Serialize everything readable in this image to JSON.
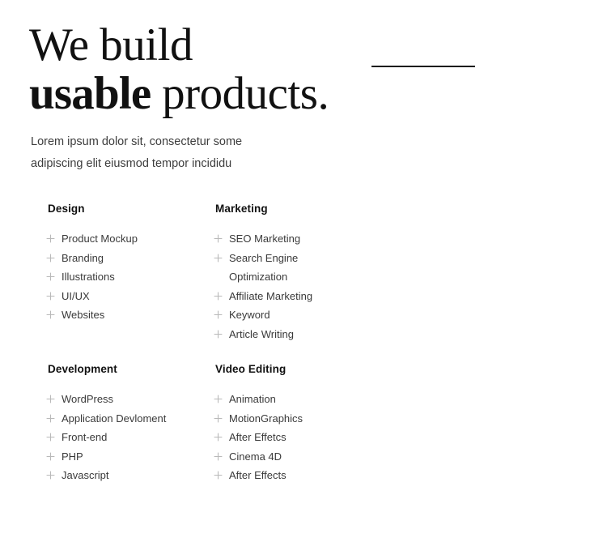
{
  "hero": {
    "headline_line1": "We build",
    "headline_line2_bold": "usable",
    "headline_line2_rest": " products.",
    "divider": "horizontal-rule"
  },
  "intro": {
    "line1": "Lorem ipsum dolor sit, consectetur some",
    "line2": "adipiscing elit eiusmod tempor incididu"
  },
  "colors": {
    "background": "#ffffff",
    "headline": "#111111",
    "body_text": "#3a3a3a",
    "intro_text": "#3d3d3d",
    "plus_icon": "#b9b9b9",
    "divider": "#1a1a1a"
  },
  "groups": [
    {
      "title": "Design",
      "items": [
        {
          "label": "Product Mockup",
          "icon": "plus-icon",
          "continuation": false
        },
        {
          "label": "Branding",
          "icon": "plus-icon",
          "continuation": false
        },
        {
          "label": "Illustrations",
          "icon": "plus-icon",
          "continuation": false
        },
        {
          "label": "UI/UX",
          "icon": "plus-icon",
          "continuation": false
        },
        {
          "label": "Websites",
          "icon": "plus-icon",
          "continuation": false
        }
      ]
    },
    {
      "title": "Marketing",
      "items": [
        {
          "label": "SEO Marketing",
          "icon": "plus-icon",
          "continuation": false
        },
        {
          "label": "Search Engine",
          "icon": "plus-icon",
          "continuation": false
        },
        {
          "label": "Optimization",
          "icon": "none",
          "continuation": true
        },
        {
          "label": "Affiliate Marketing",
          "icon": "plus-icon",
          "continuation": false
        },
        {
          "label": "Keyword",
          "icon": "plus-icon",
          "continuation": false
        },
        {
          "label": "Article Writing",
          "icon": "plus-icon",
          "continuation": false
        }
      ]
    },
    {
      "title": "Development",
      "items": [
        {
          "label": "WordPress",
          "icon": "plus-icon",
          "continuation": false
        },
        {
          "label": "Application Devloment",
          "icon": "plus-icon",
          "continuation": false
        },
        {
          "label": "Front-end",
          "icon": "plus-icon",
          "continuation": false
        },
        {
          "label": "PHP",
          "icon": "plus-icon",
          "continuation": false
        },
        {
          "label": "Javascript",
          "icon": "plus-icon",
          "continuation": false
        }
      ]
    },
    {
      "title": "Video Editing",
      "items": [
        {
          "label": "Animation",
          "icon": "plus-icon",
          "continuation": false
        },
        {
          "label": "MotionGraphics",
          "icon": "plus-icon",
          "continuation": false
        },
        {
          "label": "After Effetcs",
          "icon": "plus-icon",
          "continuation": false
        },
        {
          "label": "Cinema 4D",
          "icon": "plus-icon",
          "continuation": false
        },
        {
          "label": "After Effects",
          "icon": "plus-icon",
          "continuation": false
        }
      ]
    }
  ]
}
